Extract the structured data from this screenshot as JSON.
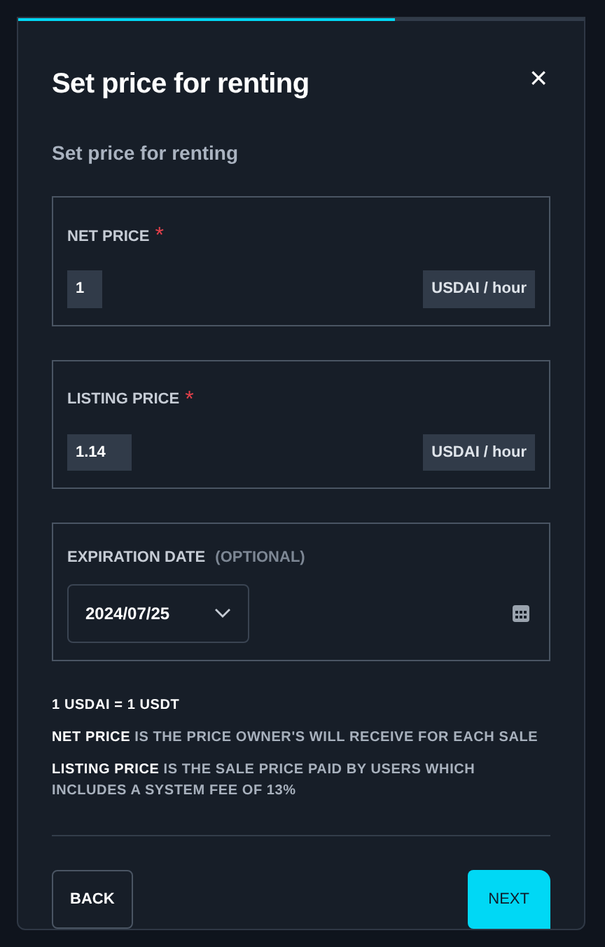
{
  "modal": {
    "progress": {
      "level": 0.667
    },
    "title": "Set price for renting",
    "close": "×",
    "subtitle": "Set price for renting",
    "fields": [
      {
        "kind": "price",
        "label": "NET PRICE",
        "marker": "*",
        "value": "1",
        "unit": "USDAI / hour"
      },
      {
        "kind": "price",
        "label": "LISTING PRICE",
        "marker": "*",
        "value": "1.14",
        "unit": "USDAI / hour"
      },
      {
        "kind": "date",
        "label": "EXPIRATION DATE",
        "note": "(OPTIONAL)",
        "value": "2024/07/25"
      }
    ],
    "notes": [
      "**1 USDAI = 1 USDT**",
      "**NET PRICE** IS THE PRICE OWNER'S WILL RECEIVE FOR EACH SALE",
      "**LISTING PRICE** IS THE SALE PRICE PAID BY USERS WHICH INCLUDES A SYSTEM FEE OF 13%"
    ],
    "buttons": [
      {
        "kind": "outline",
        "label": "BACK"
      },
      {
        "kind": "filled",
        "label": "NEXT"
      }
    ]
  }
}
